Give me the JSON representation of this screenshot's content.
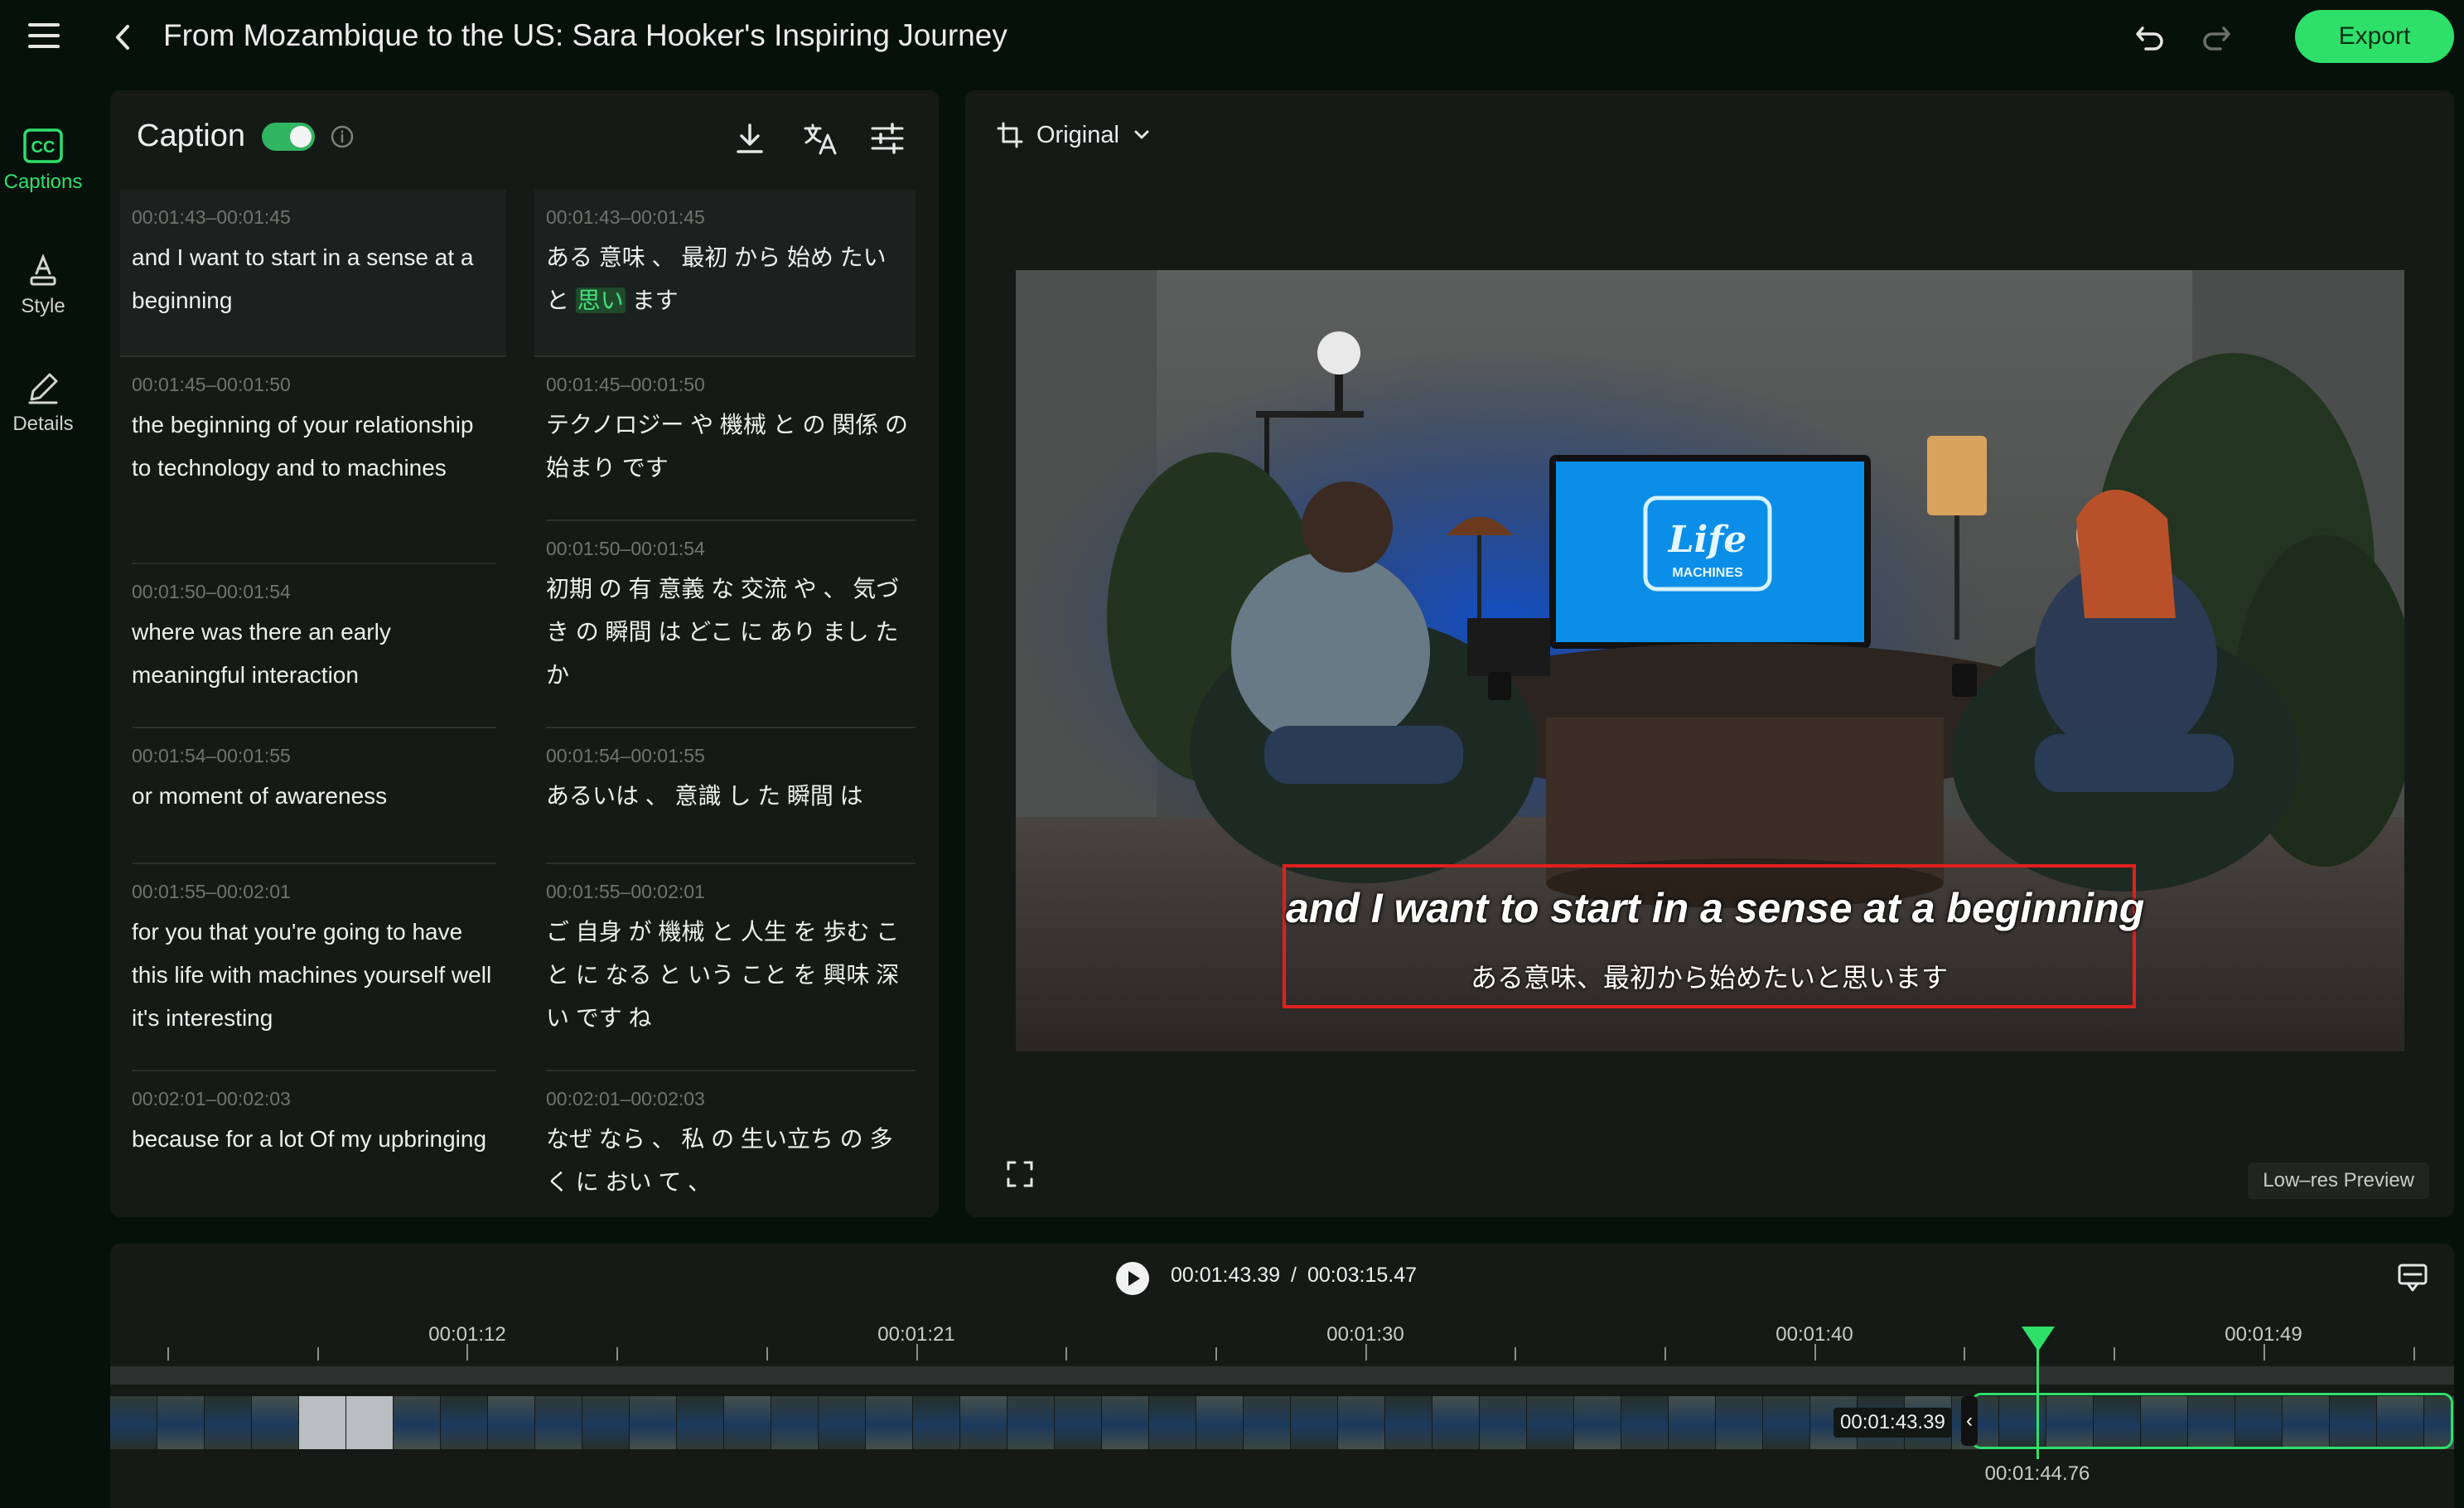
{
  "header": {
    "title": "From Mozambique to the US: Sara Hooker's Inspiring Journey",
    "export_label": "Export"
  },
  "rail": [
    {
      "label": "Captions",
      "icon": "cc-icon"
    },
    {
      "label": "Style",
      "icon": "style-icon"
    },
    {
      "label": "Details",
      "icon": "edit-icon"
    }
  ],
  "caption_panel": {
    "title": "Caption",
    "toggle_on": true,
    "original": [
      {
        "time": "00:01:43–00:01:45",
        "text": "and I want to start in a sense at a beginning"
      },
      {
        "time": "00:01:45–00:01:50",
        "text": "the beginning of your relationship to technology and to machines"
      },
      {
        "time": "00:01:50–00:01:54",
        "text": "where was there an early meaningful interaction"
      },
      {
        "time": "00:01:54–00:01:55",
        "text": "or moment of awareness"
      },
      {
        "time": "00:01:55–00:02:01",
        "text": "for you that you're going to have this life with machines yourself well it's interesting"
      },
      {
        "time": "00:02:01–00:02:03",
        "text": "because for a lot Of my upbringing"
      }
    ],
    "translation": [
      {
        "time": "00:01:43–00:01:45",
        "pre": "ある 意味 、 最初 から 始め たい と ",
        "highlight": "思い",
        "post": " ます"
      },
      {
        "time": "00:01:45–00:01:50",
        "pre": "テクノロジー や 機械 と の 関係 の 始まり です",
        "highlight": "",
        "post": ""
      },
      {
        "time": "00:01:50–00:01:54",
        "pre": "初期 の 有 意義 な 交流 や 、 気づき の 瞬間 は どこ に あり まし た か",
        "highlight": "",
        "post": ""
      },
      {
        "time": "00:01:54–00:01:55",
        "pre": "あるいは 、 意識 し た 瞬間 は",
        "highlight": "",
        "post": ""
      },
      {
        "time": "00:01:55–00:02:01",
        "pre": "ご 自身 が 機械 と 人生 を 歩む こと に なる と いう こと を 興味 深い です ね",
        "highlight": "",
        "post": ""
      },
      {
        "time": "00:02:01–00:02:03",
        "pre": "なぜ なら 、 私 の 生い立ち の 多く に おい て 、",
        "highlight": "",
        "post": ""
      }
    ]
  },
  "preview": {
    "ratio_label": "Original",
    "subtitle_en": "and I want to start in a sense at a beginning",
    "subtitle_ja": "ある意味、最初から始めたいと思います",
    "logo_text": "Life",
    "logo_sub": "MACHINES",
    "low_res_label": "Low–res Preview"
  },
  "timeline": {
    "current": "00:01:43.39",
    "total": "00:03:15.47",
    "separator": "/",
    "labels": [
      "00:01:12",
      "00:01:21",
      "00:01:30",
      "00:01:40",
      "00:01:49"
    ],
    "hover_time": "00:01:43.39",
    "playhead_time": "00:01:44.76"
  },
  "colors": {
    "accent": "#2ee06a",
    "panel": "#151a17",
    "background": "#07110c",
    "subtitle_box": "#e0201e"
  }
}
